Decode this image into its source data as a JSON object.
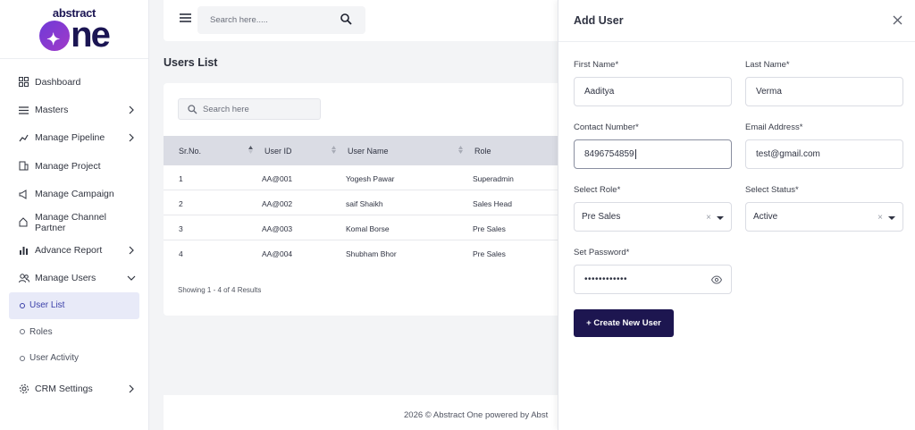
{
  "brand": {
    "logo_small": "abstract",
    "logo_big": "ne"
  },
  "sidebar": {
    "items": [
      {
        "label": "Dashboard",
        "icon": "grid-icon",
        "has_chevron": false
      },
      {
        "label": "Masters",
        "icon": "list-icon",
        "has_chevron": true
      },
      {
        "label": "Manage Pipeline",
        "icon": "pipeline-icon",
        "has_chevron": true
      },
      {
        "label": "Manage Project",
        "icon": "building-icon",
        "has_chevron": false
      },
      {
        "label": "Manage Campaign",
        "icon": "megaphone-icon",
        "has_chevron": false
      },
      {
        "label": "Manage Channel Partner",
        "icon": "partner-icon",
        "has_chevron": false
      },
      {
        "label": "Advance Report",
        "icon": "bar-chart-icon",
        "has_chevron": true
      },
      {
        "label": "Manage Users",
        "icon": "users-icon",
        "has_chevron": true,
        "expanded": true
      }
    ],
    "sub_items": [
      {
        "label": "User List",
        "active": true
      },
      {
        "label": "Roles",
        "active": false
      },
      {
        "label": "User Activity",
        "active": false
      }
    ],
    "settings": {
      "label": "CRM Settings",
      "icon": "gear-icon"
    }
  },
  "topbar": {
    "search_placeholder": "Search here....."
  },
  "users_list": {
    "title": "Users List",
    "search_placeholder": "Search here",
    "columns": [
      "Sr.No.",
      "User ID",
      "User Name",
      "Role"
    ],
    "rows": [
      {
        "sr": "1",
        "user_id": "AA@001",
        "name": "Yogesh Pawar",
        "role": "Superadmin"
      },
      {
        "sr": "2",
        "user_id": "AA@002",
        "name": "saif Shaikh",
        "role": "Sales Head"
      },
      {
        "sr": "3",
        "user_id": "AA@003",
        "name": "Komal Borse",
        "role": "Pre Sales"
      },
      {
        "sr": "4",
        "user_id": "AA@004",
        "name": "Shubham Bhor",
        "role": "Pre Sales"
      }
    ],
    "showing": "Showing 1 - 4 of 4 Results"
  },
  "footer": {
    "text": "2026 © Abstract One powered by Abst"
  },
  "add_user": {
    "title": "Add User",
    "first_name": {
      "label": "First Name*",
      "value": "Aaditya"
    },
    "last_name": {
      "label": "Last Name*",
      "value": "Verma"
    },
    "contact": {
      "label": "Contact Number*",
      "value": "8496754859"
    },
    "email": {
      "label": "Email Address*",
      "value": "test@gmail.com"
    },
    "role": {
      "label": "Select Role*",
      "value": "Pre Sales"
    },
    "status": {
      "label": "Select Status*",
      "value": "Active"
    },
    "password": {
      "label": "Set Password*",
      "value": "••••••••••••"
    },
    "submit_label": "+ Create New User"
  },
  "colors": {
    "primary": "#1d1650",
    "active_bg": "#e8eaf8",
    "header_bg": "#dadce4"
  }
}
